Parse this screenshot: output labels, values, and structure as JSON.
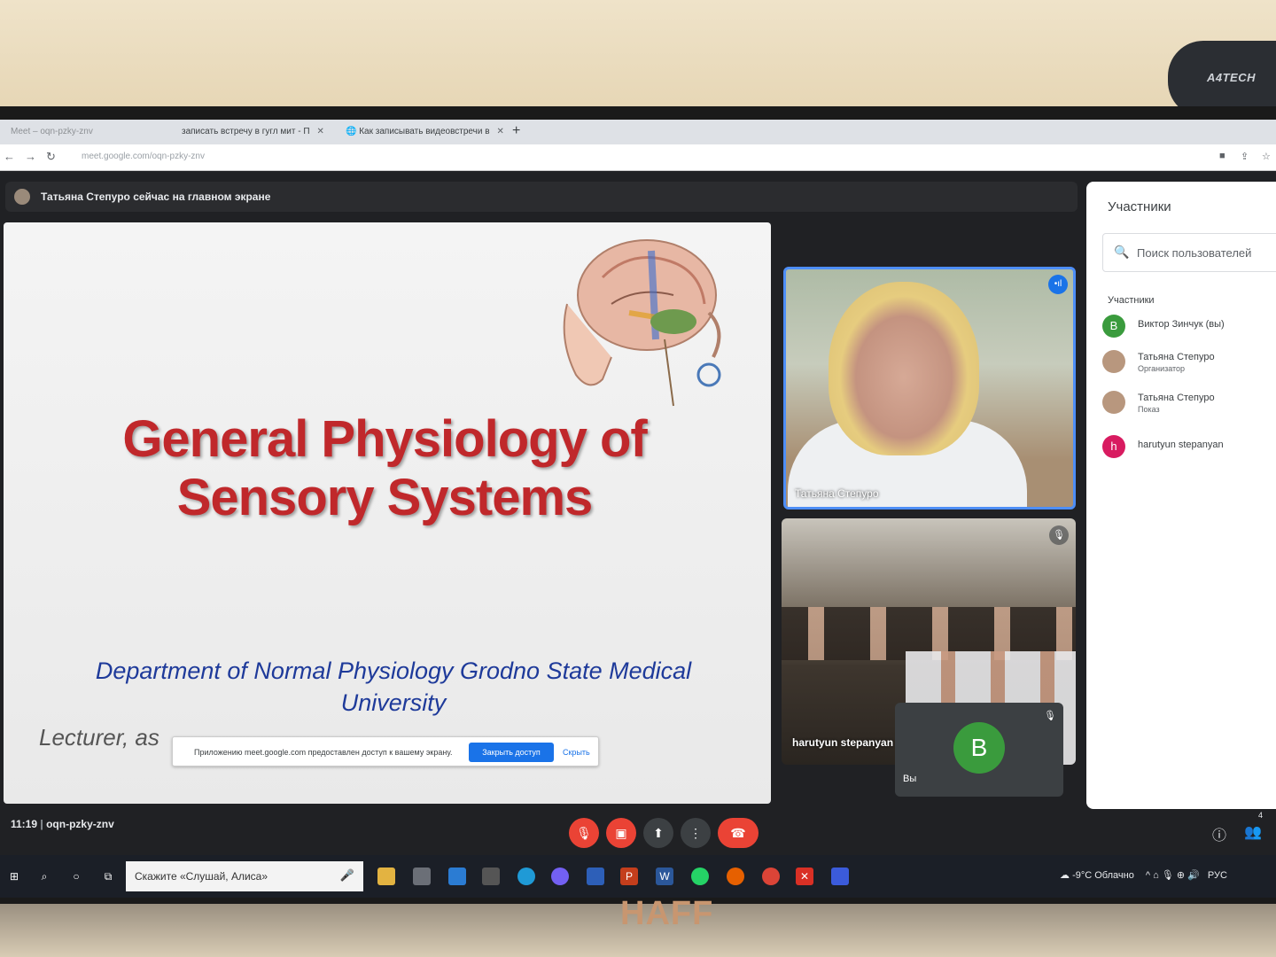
{
  "environment": {
    "webcam_brand": "A4TECH",
    "monitor_brand": "HAFF"
  },
  "browser": {
    "tabs": [
      {
        "label": "Meet – oqn-pzky-znv",
        "active": true
      },
      {
        "label": "записать встречу в гугл мит - П",
        "active": false
      },
      {
        "label": "Как записывать видеовстречи в",
        "active": false
      }
    ],
    "new_tab": "+",
    "url": "meet.google.com/oqn-pzky-znv"
  },
  "meet": {
    "presenting_banner": "Татьяна Степуро сейчас на главном экране",
    "slide": {
      "title_line1": "General Physiology of",
      "title_line2": "Sensory Systems",
      "department_line1": "Department of Normal Physiology Grodno State Medical",
      "department_line2": "University",
      "lecturer": "Lecturer, as"
    },
    "share_bar": {
      "message": "Приложению meet.google.com предоставлен доступ к вашему экрану.",
      "stop_label": "Закрыть доступ",
      "hide_label": "Скрыть"
    },
    "tiles": {
      "main_name": "Татьяна Степуро",
      "class_name": "harutyun stepanyan",
      "self_initial": "В",
      "self_name": "Вы"
    },
    "meeting_time": "11:19",
    "meeting_code": "oqn-pzky-znv",
    "participant_count": "4"
  },
  "panel": {
    "title": "Участники",
    "search_placeholder": "Поиск пользователей",
    "section_label": "Участники",
    "people": [
      {
        "initial": "В",
        "name": "Виктор Зинчук (вы)",
        "role": "",
        "color": "#3a9b3d"
      },
      {
        "initial": "",
        "name": "Татьяна Степуро",
        "role": "Организатор",
        "color": "#b8977e"
      },
      {
        "initial": "",
        "name": "Татьяна Степуро",
        "role": "Показ",
        "color": "#b8977e"
      },
      {
        "initial": "h",
        "name": "harutyun stepanyan",
        "role": "",
        "color": "#d81b60"
      }
    ]
  },
  "taskbar": {
    "search_text": "Скажите «Слушай, Алиса»",
    "weather": "-9°C Облачно",
    "lang": "РУС"
  }
}
